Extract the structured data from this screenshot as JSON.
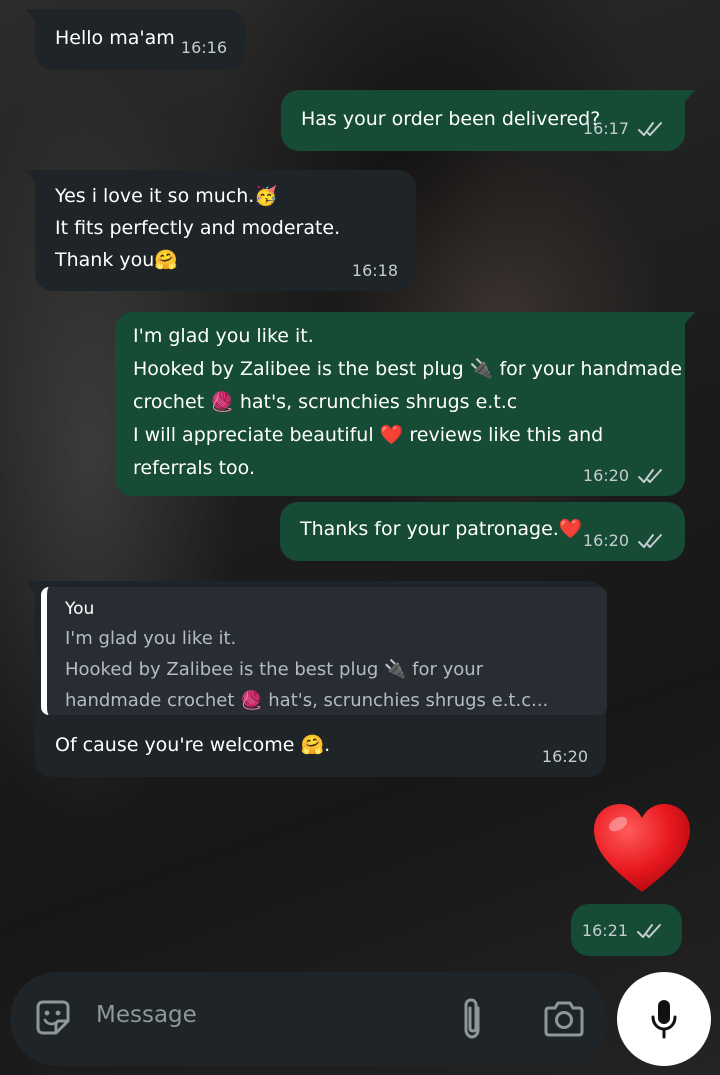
{
  "messages": [
    {
      "text": "Hello ma'am",
      "time": "16:16"
    },
    {
      "text": "Has your order been delivered?",
      "time": "16:17"
    },
    {
      "text": "Yes i love it so much.🥳\nIt fits perfectly and moderate.\nThank you🤗",
      "time": "16:18"
    },
    {
      "text": "I'm glad you like it.\nHooked by Zalibee is the best plug 🔌 for your handmade\ncrochet 🧶 hat's, scrunchies shrugs e.t.c\nI will appreciate beautiful ❤️ reviews like this and\nreferrals too.",
      "time": "16:20"
    },
    {
      "text": "Thanks for your patronage.❤️",
      "time": "16:20"
    },
    {
      "quote_author": "You",
      "quote_text": "I'm glad you like it.\nHooked by Zalibee is the best plug 🔌 for your\nhandmade crochet 🧶 hat's, scrunchies shrugs e.t.c...",
      "text": "Of cause you're welcome 🤗.",
      "time": "16:20"
    },
    {
      "emoji": "heart",
      "time": "16:21"
    }
  ],
  "input": {
    "placeholder": "Message"
  },
  "colors": {
    "incoming": "#1f2428",
    "outgoing": "#164b35",
    "read_ticks": "#c4ccd0"
  },
  "icons": [
    "sticker-icon",
    "attach-icon",
    "camera-icon",
    "mic-icon",
    "double-check-icon",
    "heart-emoji"
  ]
}
